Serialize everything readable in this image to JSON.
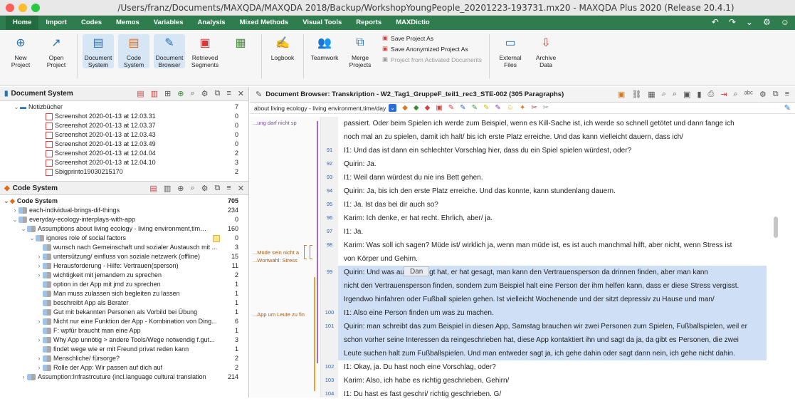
{
  "window": {
    "title": "/Users/franz/Documents/MAXQDA/MAXQDA 2018/Backup/WorkshopYoungPeople_20201223-193731.mx20 - MAXQDA Plus 2020 (Release 20.4.1)"
  },
  "menu": {
    "tabs": [
      "Home",
      "Import",
      "Codes",
      "Memos",
      "Variables",
      "Analysis",
      "Mixed Methods",
      "Visual Tools",
      "Reports",
      "MAXDictio"
    ]
  },
  "ribbon": {
    "buttons": [
      {
        "label": "New\nProject"
      },
      {
        "label": "Open\nProject"
      },
      {
        "label": "Document\nSystem"
      },
      {
        "label": "Code\nSystem"
      },
      {
        "label": "Document\nBrowser"
      },
      {
        "label": "Retrieved\nSegments"
      },
      {
        "label": "Logbook"
      },
      {
        "label": "Teamwork"
      },
      {
        "label": "Merge\nProjects"
      },
      {
        "label": "External\nFiles"
      },
      {
        "label": "Archive\nData"
      }
    ],
    "save_as": "Save Project As",
    "save_anon": "Save Anonymized Project As",
    "project_from_docs": "Project from Activated Documents"
  },
  "document_system": {
    "title": "Document System",
    "items": [
      {
        "label": "Notizbücher",
        "count": "7"
      },
      {
        "label": "Screenshot 2020-01-13 at 12.03.31",
        "count": "0"
      },
      {
        "label": "Screenshot 2020-01-13 at 12.03.37",
        "count": "0"
      },
      {
        "label": "Screenshot 2020-01-13 at 12.03.43",
        "count": "0"
      },
      {
        "label": "Screenshot 2020-01-13 at 12.03.49",
        "count": "0"
      },
      {
        "label": "Screenshot 2020-01-13 at 12.04.04",
        "count": "2"
      },
      {
        "label": "Screenshot 2020-01-13 at 12.04.10",
        "count": "3"
      },
      {
        "label": "Sbigprinto19030215170",
        "count": "2"
      }
    ]
  },
  "code_system": {
    "title": "Code System",
    "items": [
      {
        "label": "Code System",
        "count": "705"
      },
      {
        "label": "each-individual-brings-dif-things",
        "count": "234"
      },
      {
        "label": "everyday-ecology-interplays-with-app",
        "count": "0"
      },
      {
        "label": "Assumptions about living ecology - living environment,time/...",
        "count": "160"
      },
      {
        "label": "ignores role of social factors",
        "count": "0"
      },
      {
        "label": "wunsch nach Gemeinschaft und sozialer Austausch mit ...",
        "count": "3"
      },
      {
        "label": "untersützung/ einfluss von soziale netzwerk (offline)",
        "count": "15"
      },
      {
        "label": "Herausforderung - Hilfe: Vertrauen(sperson)",
        "count": "11"
      },
      {
        "label": "wichtigkeit mit jemandem zu sprechen",
        "count": "2"
      },
      {
        "label": "option in der App mit jmd zu sprechen",
        "count": "1"
      },
      {
        "label": "Man muss zulassen sich begleiten zu lassen",
        "count": "1"
      },
      {
        "label": "beschreibt App als Berater",
        "count": "1"
      },
      {
        "label": "Gut mit bekannten Personen als Vorbild bei Übung",
        "count": "1"
      },
      {
        "label": "Nicht nur eine Funktion der App - Kombination von Ding...",
        "count": "6"
      },
      {
        "label": "F: wpfür braucht man eine App",
        "count": "1"
      },
      {
        "label": "Why App unnötig > andere Tools/Wege notwendig f.gut...",
        "count": "3"
      },
      {
        "label": "findet wege wie er mit Freund privat reden kann",
        "count": "1"
      },
      {
        "label": "Menschliche/ fürsorge?",
        "count": "2"
      },
      {
        "label": "Rolle der App: Wir passen auf dich auf",
        "count": "2"
      },
      {
        "label": "Assumption:Infrastrcuture (incl.language  cultural translation",
        "count": "214"
      }
    ]
  },
  "browser": {
    "title": "Document Browser: Transkription - W2_Tag1_GruppeF_teil1_rec3_STE-002  (305 Paragraphs)",
    "code_dropdown": "about living ecology - living environment,time/day",
    "memos": [
      "...ung darf nicht sp",
      "...Müde sein nicht a",
      "...Wortwahl: Stress",
      "...App um Leute zu fin"
    ],
    "tooltip": "Dan",
    "lines": [
      {
        "num": "",
        "text": "passiert. Oder beim Spielen ich werde zum Beispiel, wenn es Kill-Sache ist, ich werde so schnell getötet und dann fange ich",
        "hl": false
      },
      {
        "num": "",
        "text": "noch mal an zu spielen, damit ich halt/ bis ich erste Platz erreiche. Und das kann vielleicht dauern, dass ich/",
        "hl": false
      },
      {
        "num": "91",
        "text": "I1: Und das ist dann ein schlechter Vorschlag hier, dass du ein Spiel spielen würdest, oder?",
        "hl": false
      },
      {
        "num": "92",
        "text": "Quirin: Ja.",
        "hl": false
      },
      {
        "num": "93",
        "text": "I1: Weil dann würdest du nie ins Bett gehen.",
        "hl": false
      },
      {
        "num": "94",
        "text": "Quirin: Ja, bis ich den erste Platz erreiche. Und das konnte, kann stundenlang dauern.",
        "hl": false
      },
      {
        "num": "95",
        "text": "I1: Ja. Ist das bei dir auch so?",
        "hl": false
      },
      {
        "num": "96",
        "text": "Karim: Ich denke, er hat recht. Ehrlich, aber/ ja.",
        "hl": false
      },
      {
        "num": "97",
        "text": "I1: Ja.",
        "hl": false
      },
      {
        "num": "98",
        "text": "Karim: Was soll ich sagen? Müde ist/ wirklich ja, wenn man müde ist, es ist auch manchmal hilft, aber nicht, wenn Stress ist",
        "hl": false
      },
      {
        "num": "",
        "text": "von Körper und Gehirn.",
        "hl": false
      },
      {
        "num": "99",
        "text": "Quirin: Und was            auch gesagt hat, er hat gesagt, man kann den Vertrauensperson da drinnen finden, aber man kann",
        "hl": true
      },
      {
        "num": "",
        "text": "nicht den Vertrauensperson finden, sondern zum Beispiel halt eine Person der ihm helfen kann, dass er diese Stress vergisst.",
        "hl": true
      },
      {
        "num": "",
        "text": "Irgendwo hinfahren oder Fußball spielen gehen. Ist vielleicht Wochenende und der sitzt depressiv zu Hause und man/",
        "hl": true
      },
      {
        "num": "100",
        "text": "I1: Also eine Person finden um was zu machen.",
        "hl": true
      },
      {
        "num": "101",
        "text": "Quirin: man schreibt das zum Beispiel in diesen App, Samstag brauchen wir zwei Personen zum Spielen, Fußballspielen, weil er",
        "hl": true
      },
      {
        "num": "",
        "text": "schon vorher seine Interessen da reingeschrieben hat, diese App kontaktiert ihn und sagt da ja, da gibt es Personen, die zwei",
        "hl": true
      },
      {
        "num": "",
        "text": "Leute suchen halt zum Fußballspielen. Und man entweder sagt ja, ich gehe dahin oder sagt dann nein, ich gehe nicht dahin.",
        "hl": true
      },
      {
        "num": "102",
        "text": "I1: Okay, ja. Du hast noch eine Vorschlag, oder?",
        "hl": false
      },
      {
        "num": "103",
        "text": "Karim: Also, ich habe es richtig geschrieben, Gehirn/",
        "hl": false
      },
      {
        "num": "104",
        "text": "I1: Du hast es fast geschri/ richtig geschrieben. G/",
        "hl": false
      }
    ]
  }
}
